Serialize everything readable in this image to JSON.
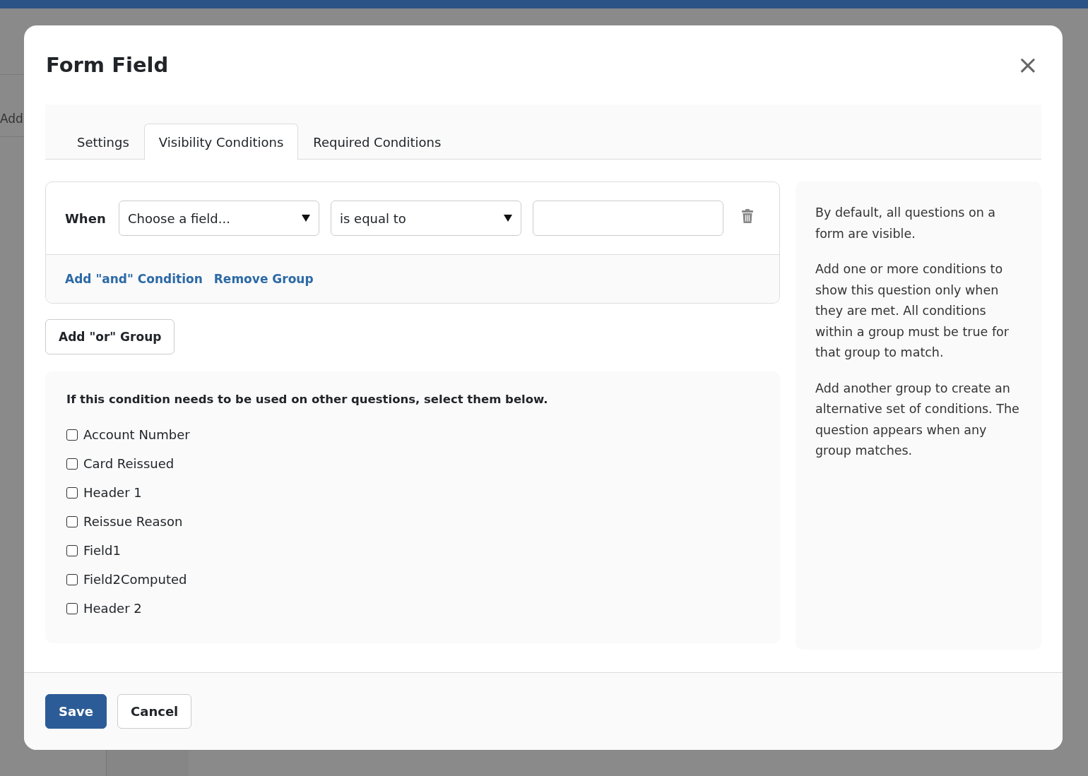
{
  "background": {
    "partial_button": "Add"
  },
  "dialog": {
    "title": "Form Field",
    "close": "×"
  },
  "tabs": [
    {
      "label": "Settings",
      "selected": false
    },
    {
      "label": "Visibility Conditions",
      "selected": true
    },
    {
      "label": "Required Conditions",
      "selected": false
    }
  ],
  "condition_group": {
    "label": "When",
    "field_select": {
      "value": "Choose a field..."
    },
    "operator_select": {
      "value": "is equal to"
    },
    "links": [
      "Add \"and\" Condition",
      "Remove Group"
    ]
  },
  "add_group_button": "Add \"or\" Group",
  "apply_to": {
    "heading": "If this condition needs to be used on other questions, select them below.",
    "items": [
      {
        "label": "Account Number",
        "checked": false
      },
      {
        "label": "Card Reissued",
        "checked": false
      },
      {
        "label": "Header 1",
        "checked": false
      },
      {
        "label": "Reissue Reason",
        "checked": false
      },
      {
        "label": "Field1",
        "checked": false
      },
      {
        "label": "Field2Computed",
        "checked": false
      },
      {
        "label": "Header 2",
        "checked": false
      }
    ]
  },
  "help": [
    "By default, all questions on a form are visible.",
    "Add one or more conditions to show this question only when they are met. All conditions within a group must be true for that group to match.",
    "Add another group to create an alternative set of conditions. The question appears when any group matches."
  ],
  "footer": {
    "buttons": [
      {
        "label": "Save",
        "kind": "primary"
      },
      {
        "label": "Cancel",
        "kind": "secondary"
      }
    ]
  }
}
